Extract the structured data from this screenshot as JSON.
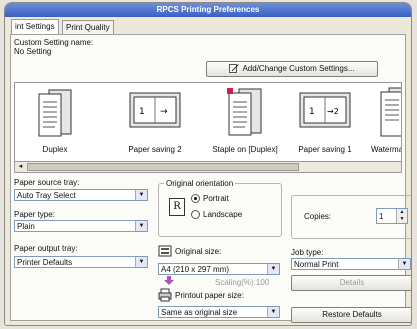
{
  "window": {
    "title": "RPCS Printing Preferences"
  },
  "tabs": [
    {
      "label": "int Settings"
    },
    {
      "label": "Print Quality"
    }
  ],
  "custom_setting": {
    "label": "Custom Setting name:",
    "value": "No Setting",
    "button": "Add/Change Custom Settings..."
  },
  "layouts": [
    {
      "label": "Duplex"
    },
    {
      "label": "Paper saving 2"
    },
    {
      "label": "Staple on [Duplex]"
    },
    {
      "label": "Paper saving 1"
    },
    {
      "label": "Watermark [I"
    }
  ],
  "paper_source": {
    "label": "Paper source tray:",
    "value": "Auto Tray Select"
  },
  "paper_type": {
    "label": "Paper type:",
    "value": "Plain"
  },
  "paper_output": {
    "label": "Paper output tray:",
    "value": "Printer Defaults"
  },
  "orientation": {
    "label": "Original orientation",
    "options": [
      "Portrait",
      "Landscape"
    ],
    "selected": "Portrait",
    "icon_letter": "R"
  },
  "copies": {
    "label": "Copies:",
    "value": "1"
  },
  "original_size": {
    "label": "Original size:",
    "value": "A4 (210 x 297 mm)"
  },
  "scaling": {
    "label": "Scaling(%):100"
  },
  "printout_size": {
    "label": "Printout paper size:",
    "value": "Same as original size"
  },
  "job_type": {
    "label": "Job type:",
    "value": "Normal Print",
    "details_button": "Details"
  },
  "restore_button": "Restore Defaults"
}
